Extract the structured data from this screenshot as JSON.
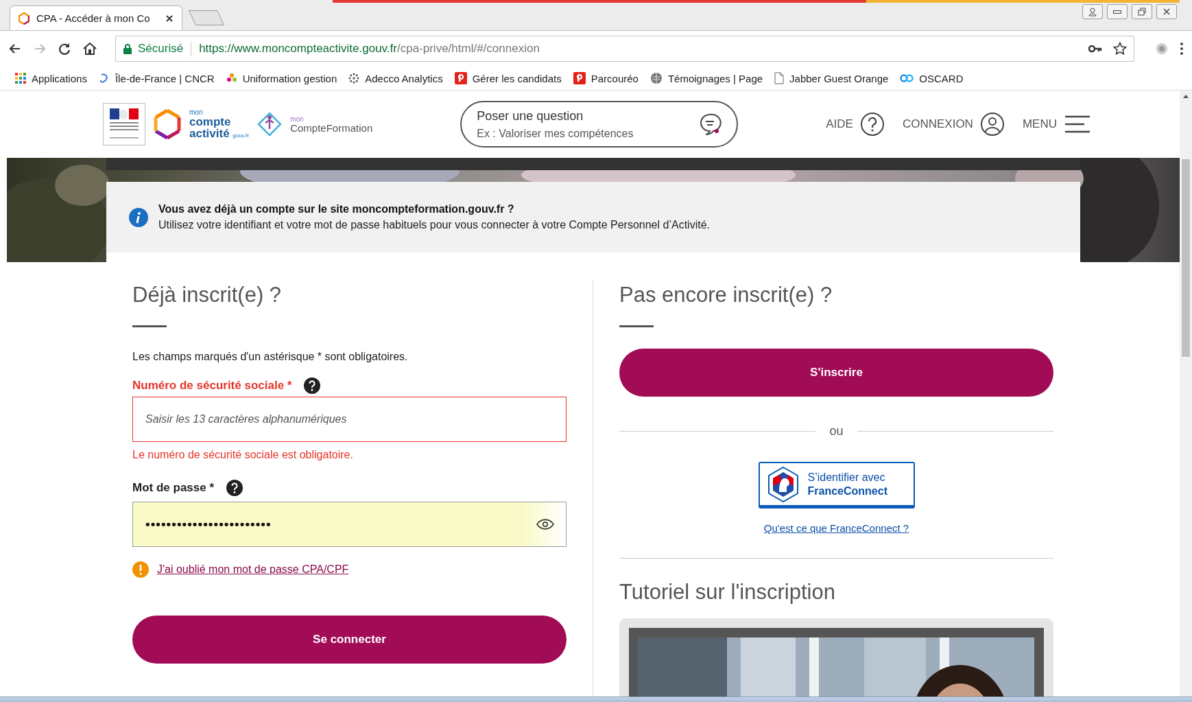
{
  "browser": {
    "tab": {
      "title": "CPA - Accéder à mon Co",
      "selected": true
    },
    "address": {
      "secure_label": "Sécurisé",
      "url_host": "https://www.moncompteactivite.gouv.fr",
      "url_path": "/cpa-prive/html/#/connexion"
    },
    "bookmarks": [
      {
        "kind": "apps",
        "label": "Applications"
      },
      {
        "kind": "swirl",
        "label": "Île-de-France | CNCR"
      },
      {
        "kind": "flower",
        "label": "Uniformation gestion"
      },
      {
        "kind": "dots",
        "label": "Adecco Analytics"
      },
      {
        "kind": "p",
        "label": "Gérer les candidats"
      },
      {
        "kind": "p",
        "label": "Parcouréo"
      },
      {
        "kind": "globe",
        "label": "Témoignages | Page"
      },
      {
        "kind": "page",
        "label": "Jabber Guest Orange"
      },
      {
        "kind": "link",
        "label": "OSCARD"
      }
    ]
  },
  "header": {
    "logo": {
      "mon": "mon",
      "compte": "compte",
      "activite": "activité",
      "gouv": "gouv.fr"
    },
    "logo2": {
      "mon": "mon",
      "name": "CompteFormation"
    },
    "question": {
      "title": "Poser une question",
      "example": "Ex : Valoriser mes compétences"
    },
    "nav": [
      {
        "kind": "help",
        "label": "AIDE"
      },
      {
        "kind": "user",
        "label": "CONNEXION"
      },
      {
        "kind": "menu",
        "label": "MENU"
      }
    ]
  },
  "info": {
    "title": "Vous avez déjà un compte sur le site moncompteformation.gouv.fr ?",
    "text": "Utilisez votre identifiant et votre mot de passe habituels pour vous connecter à votre Compte Personnel d’Activité."
  },
  "login": {
    "heading": "Déjà inscrit(e) ?",
    "note": "Les champs marqués d'un astérisque * sont obligatoires.",
    "fields": [
      {
        "kind": "text",
        "label": "Numéro de sécurité sociale *",
        "placeholder": "Saisir les 13 caractères alphanumériques",
        "invalid": true,
        "autofilled": false,
        "error": "Le numéro de sécurité sociale est obligatoire."
      },
      {
        "kind": "password",
        "label": "Mot de passe *",
        "value": "••••••••••••••••••••••••",
        "invalid": false,
        "autofilled": true
      }
    ],
    "forgot_link": "J'ai oublié mon mot de passe CPA/CPF",
    "submit": "Se connecter"
  },
  "register": {
    "heading": "Pas encore inscrit(e) ?",
    "button": "S'inscrire",
    "separator": "ou",
    "franceconnect": {
      "line1": "S’identifier avec",
      "line2": "FranceConnect"
    },
    "link": "Qu'est ce que FranceConnect ?",
    "tutorial": {
      "heading": "Tutoriel sur l'inscription"
    }
  }
}
